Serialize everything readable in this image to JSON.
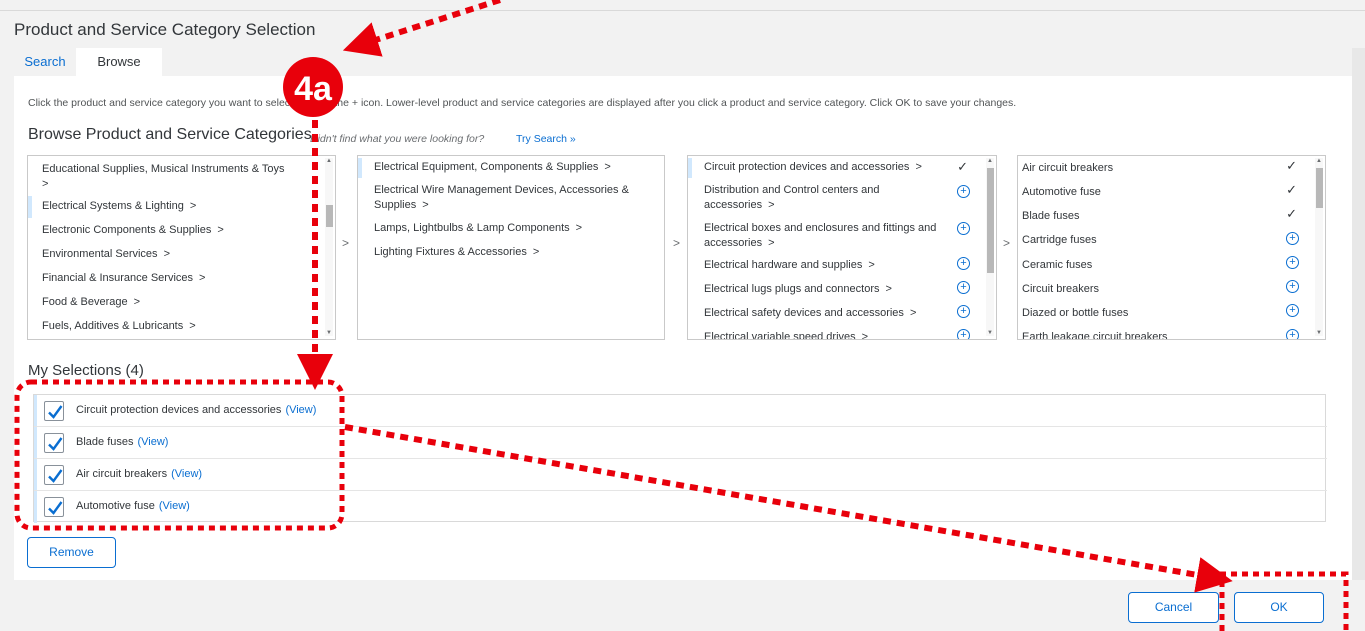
{
  "page_title": "Product and Service Category Selection",
  "tabs": [
    {
      "label": "Search"
    },
    {
      "label": "Browse"
    }
  ],
  "instructions": "Click the product and service category you want to select, or click the + icon. Lower-level product and service categories are displayed after you click a product and service category. Click OK to save your changes.",
  "browse": {
    "heading": "Browse Product and Service Categories",
    "hint": "Didn't find what you were looking for?",
    "hint_link": "Try Search »"
  },
  "columns": [
    {
      "items": [
        {
          "label": "Educational Supplies, Musical Instruments & Toys"
        },
        {
          "label": "Electrical Systems & Lighting"
        },
        {
          "label": "Electronic Components & Supplies"
        },
        {
          "label": "Environmental Services"
        },
        {
          "label": "Financial & Insurance Services"
        },
        {
          "label": "Food & Beverage"
        },
        {
          "label": "Fuels, Additives & Lubricants"
        }
      ]
    },
    {
      "items": [
        {
          "label": "Electrical Equipment, Components & Supplies"
        },
        {
          "label": "Electrical Wire Management Devices, Accessories & Supplies"
        },
        {
          "label": "Lamps, Lightbulbs & Lamp Components"
        },
        {
          "label": "Lighting Fixtures & Accessories"
        }
      ]
    },
    {
      "items": [
        {
          "label": "Circuit protection devices and accessories",
          "status": "checked"
        },
        {
          "label": "Distribution and Control centers and accessories",
          "status": "add"
        },
        {
          "label": "Electrical boxes and enclosures and fittings and accessories",
          "status": "add"
        },
        {
          "label": "Electrical hardware and supplies",
          "status": "add"
        },
        {
          "label": "Electrical lugs plugs and connectors",
          "status": "add"
        },
        {
          "label": "Electrical safety devices and accessories",
          "status": "add"
        },
        {
          "label": "Electrical variable speed drives",
          "status": "add"
        }
      ]
    },
    {
      "items": [
        {
          "label": "Air circuit breakers",
          "status": "checked"
        },
        {
          "label": "Automotive fuse",
          "status": "checked"
        },
        {
          "label": "Blade fuses",
          "status": "checked"
        },
        {
          "label": "Cartridge fuses",
          "status": "add"
        },
        {
          "label": "Ceramic fuses",
          "status": "add"
        },
        {
          "label": "Circuit breakers",
          "status": "add"
        },
        {
          "label": "Diazed or bottle fuses",
          "status": "add"
        },
        {
          "label": "Earth leakage circuit breakers",
          "status": "add"
        }
      ]
    }
  ],
  "my_selections": {
    "heading": "My Selections (4)",
    "view_label": "(View)",
    "items": [
      {
        "label": "Circuit protection devices and accessories"
      },
      {
        "label": "Blade fuses"
      },
      {
        "label": "Air circuit breakers"
      },
      {
        "label": "Automotive fuse"
      }
    ]
  },
  "buttons": {
    "remove": "Remove",
    "cancel": "Cancel",
    "ok": "OK"
  },
  "annotation": {
    "step_label": "4a",
    "color": "#e8000b"
  },
  "colors": {
    "accent": "#0a6ed1",
    "selected_bar": "#d1e8fd"
  }
}
